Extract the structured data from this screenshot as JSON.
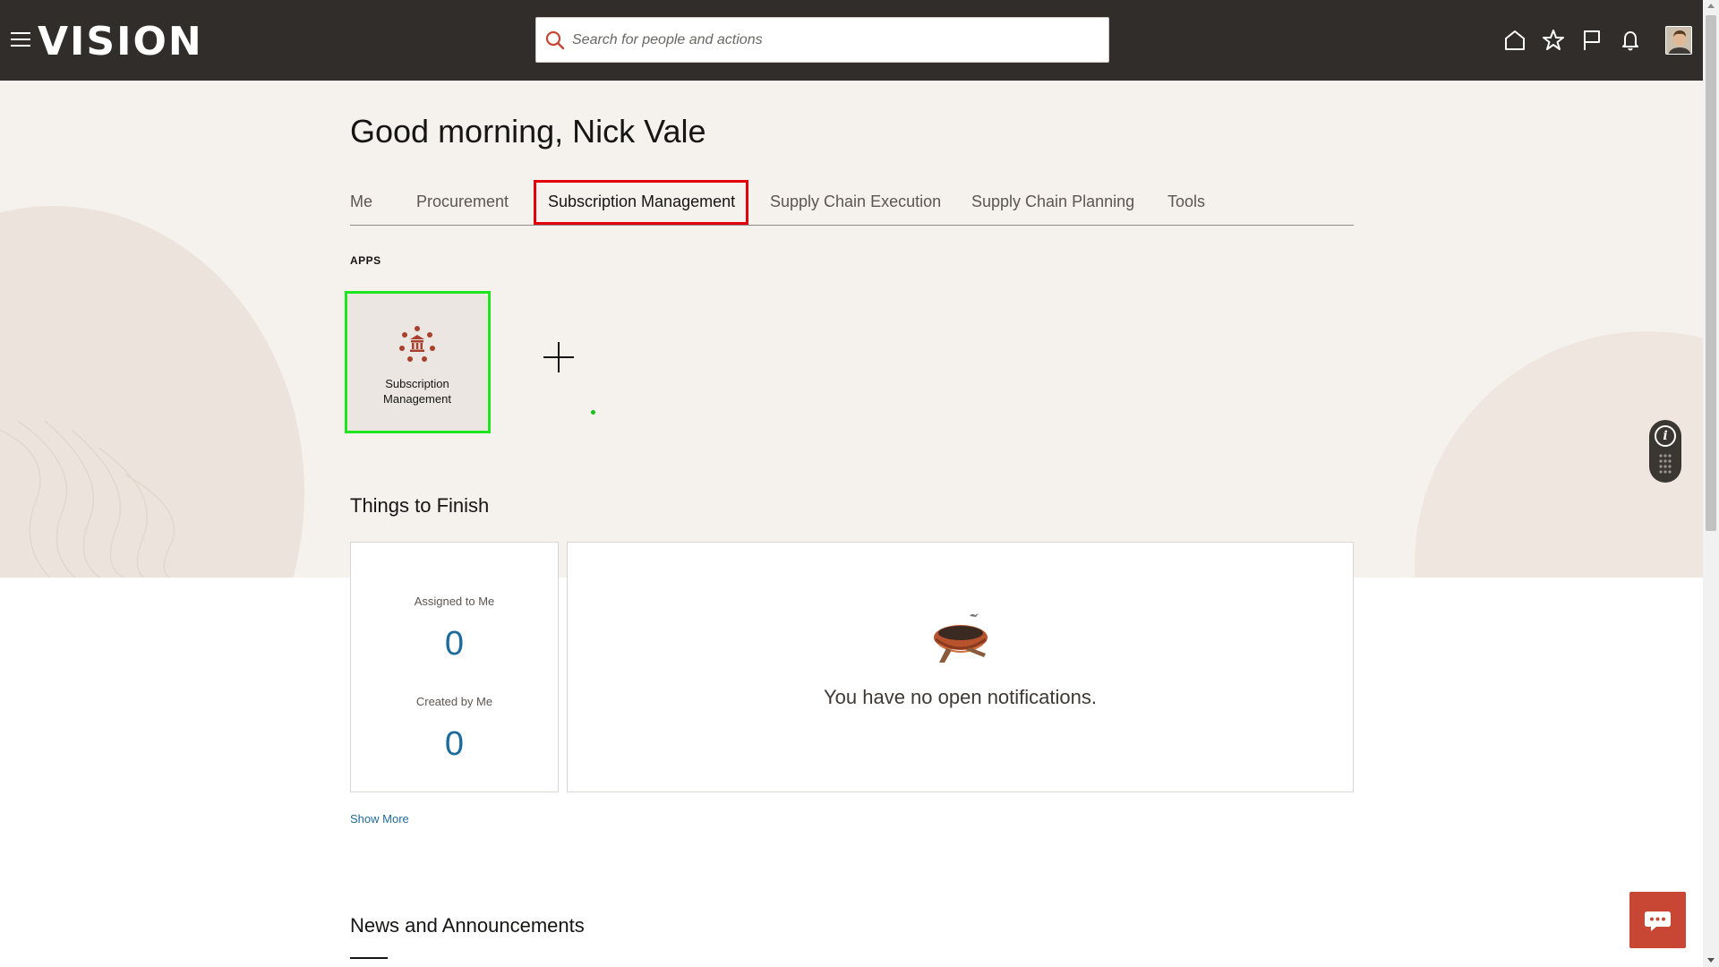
{
  "header": {
    "logo_text": "VISION",
    "search_placeholder": "Search for people and actions",
    "icons": [
      "menu-icon",
      "search-icon",
      "home-icon",
      "star-icon",
      "flag-icon",
      "bell-icon",
      "avatar"
    ]
  },
  "greeting": "Good morning, Nick Vale",
  "tabs": [
    {
      "label": "Me"
    },
    {
      "label": "Procurement"
    },
    {
      "label": "Subscription Management",
      "active": true
    },
    {
      "label": "Supply Chain Execution"
    },
    {
      "label": "Supply Chain Planning"
    },
    {
      "label": "Tools"
    }
  ],
  "apps": {
    "section_label": "APPS",
    "tiles": [
      {
        "label_line1": "Subscription",
        "label_line2": "Management",
        "icon": "subscription-management-icon"
      }
    ]
  },
  "things_to_finish": {
    "title": "Things to Finish",
    "assigned_label": "Assigned to Me",
    "assigned_count": "0",
    "created_label": "Created by Me",
    "created_count": "0",
    "empty_message": "You have no open notifications.",
    "show_more": "Show More"
  },
  "news": {
    "title": "News and Announcements"
  },
  "colors": {
    "header_bg": "#312d2a",
    "hero_bg": "#f5f1ed",
    "link": "#1d6b9c",
    "accent_red": "#c74634",
    "highlight_red": "#e3000b",
    "highlight_green": "#1ee61e"
  }
}
